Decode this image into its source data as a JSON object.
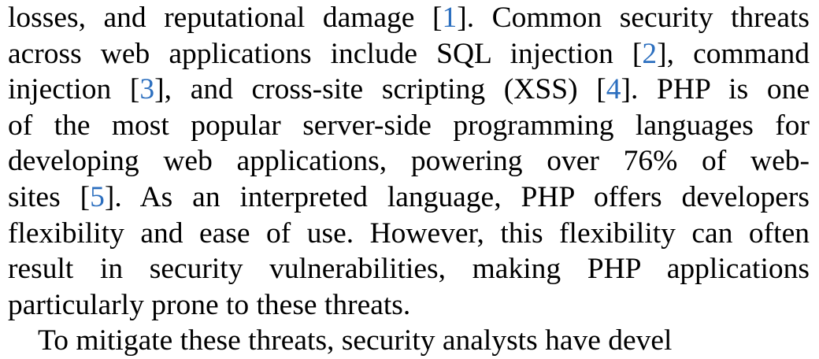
{
  "colors": {
    "citation": "#2c6fbf",
    "text": "#000000"
  },
  "paragraph": {
    "lines": [
      [
        {
          "t": "losses, and reputational damage ["
        },
        {
          "t": "1",
          "cite": true
        },
        {
          "t": "]. Common security threats"
        }
      ],
      [
        {
          "t": "across web applications include SQL injection ["
        },
        {
          "t": "2",
          "cite": true
        },
        {
          "t": "], command"
        }
      ],
      [
        {
          "t": "injection ["
        },
        {
          "t": "3",
          "cite": true
        },
        {
          "t": "], and cross-site scripting (XSS) ["
        },
        {
          "t": "4",
          "cite": true
        },
        {
          "t": "]. PHP is one"
        }
      ],
      [
        {
          "t": "of the most popular server-side programming languages for"
        }
      ],
      [
        {
          "t": "developing web applications, powering over 76% of web-"
        }
      ],
      [
        {
          "t": "sites ["
        },
        {
          "t": "5",
          "cite": true
        },
        {
          "t": "]. As an interpreted language, PHP offers developers"
        }
      ],
      [
        {
          "t": "flexibility and ease of use. However, this flexibility can often"
        }
      ],
      [
        {
          "t": "result in security vulnerabilities, making PHP applications"
        }
      ],
      [
        {
          "t": "particularly prone to these threats."
        }
      ]
    ],
    "next_paragraph_first_line": "To mitigate these threats, security analysts have devel"
  }
}
